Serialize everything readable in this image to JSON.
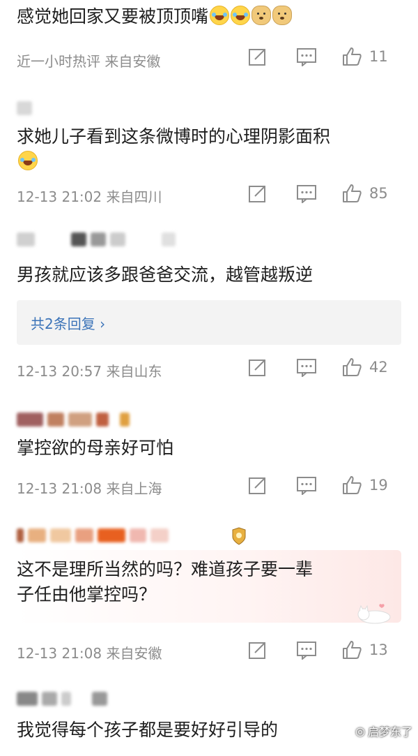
{
  "comments": [
    {
      "text": "感觉她回家又要被顶顶嘴",
      "meta": "近一小时热评  来自安徽",
      "likes": "11"
    },
    {
      "text": "求她儿子看到这条微博时的心理阴影面积",
      "meta": "12-13 21:02  来自四川",
      "likes": "85"
    },
    {
      "text": "男孩就应该多跟爸爸交流，越管越叛逆",
      "reply_link": "共2条回复",
      "meta": "12-13 20:57  来自山东",
      "likes": "42"
    },
    {
      "text": "掌控欲的母亲好可怕",
      "meta": "12-13 21:08  来自上海",
      "likes": "19"
    },
    {
      "text_line1": "这不是理所当然的吗？难道孩子要一辈",
      "text_line2": "子任由他掌控吗？",
      "meta": "12-13 21:08  来自安徽",
      "likes": "13"
    },
    {
      "text": "我觉得每个孩子都是要好好引导的"
    }
  ],
  "watermark": "启梦东了",
  "icons": {
    "share": "share-icon",
    "comment": "comment-icon",
    "like": "thumbs-up-icon",
    "reply_arrow": "chevron-right-icon",
    "emoji_laugh": "laughing-emoji-icon",
    "emoji_doge": "doge-emoji-icon"
  },
  "colors": {
    "link": "#3b73b8",
    "meta": "#8c8c8c",
    "text": "#1e1e1e"
  }
}
